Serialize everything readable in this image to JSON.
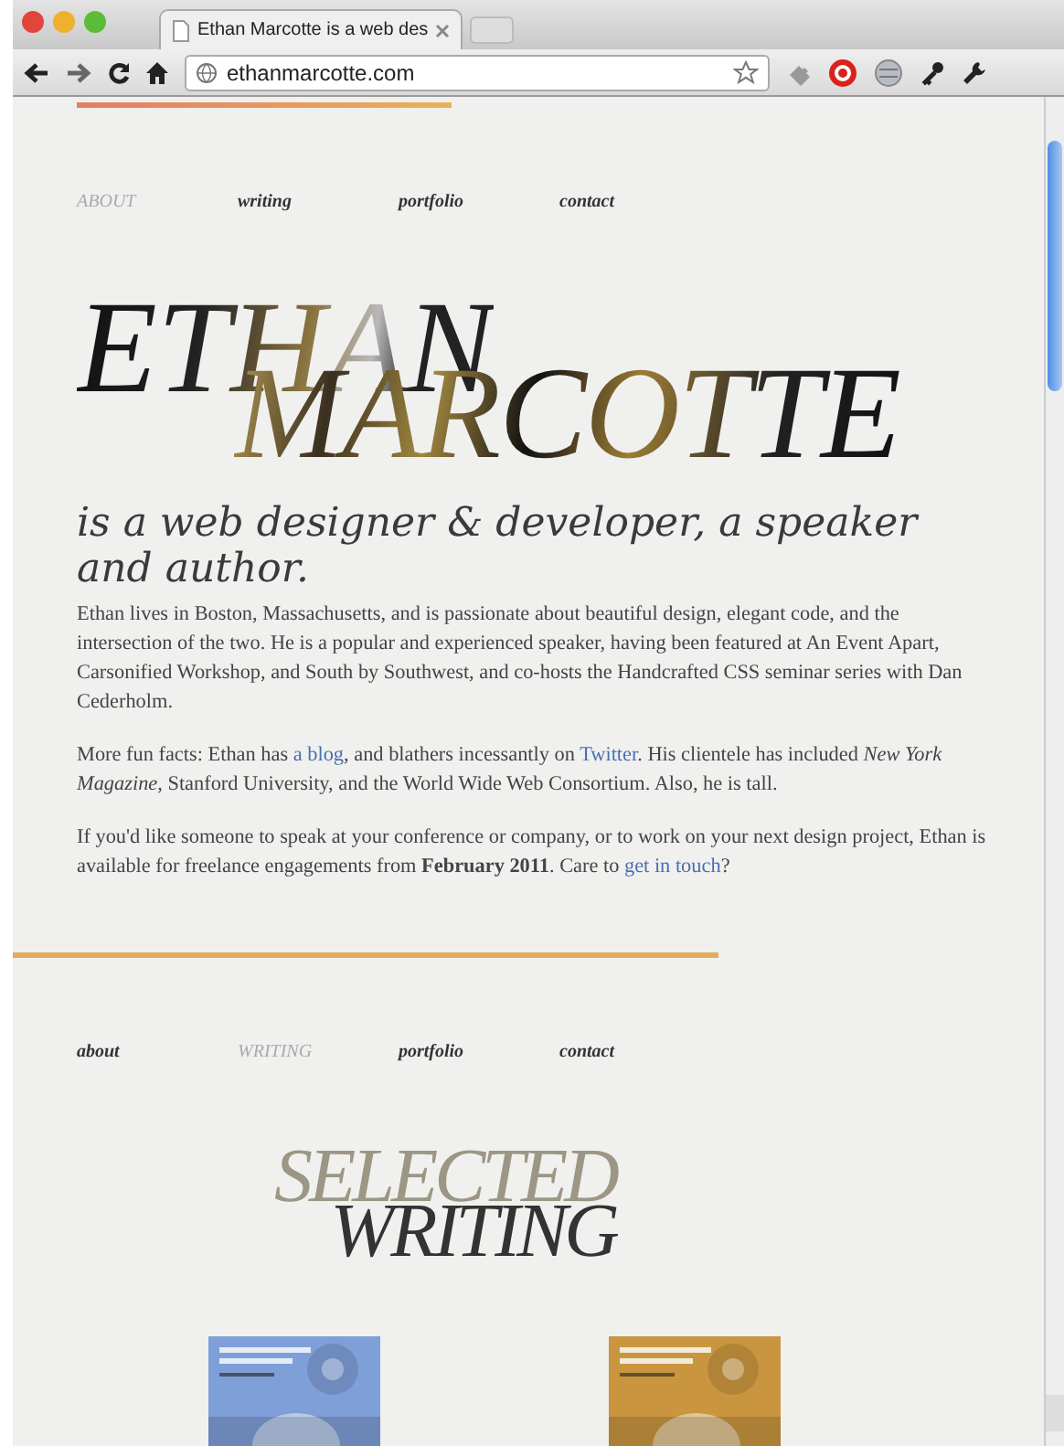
{
  "browser": {
    "tab_title": "Ethan Marcotte is a web des",
    "url": "ethanmarcotte.com"
  },
  "nav_top": [
    {
      "label": "ABOUT",
      "selected": true
    },
    {
      "label": "writing",
      "selected": false
    },
    {
      "label": "portfolio",
      "selected": false
    },
    {
      "label": "contact",
      "selected": false
    }
  ],
  "name": {
    "first": "ETHAN",
    "last": "MARCOTTE"
  },
  "tagline": "is a web designer & developer, a speaker and author.",
  "paragraphs": [
    [
      {
        "kind": "text",
        "text": "Ethan lives in Boston, Massachusetts, and is passionate about beautiful design, elegant code, and the intersection of the two. He is a popular and experienced speaker, having been featured at An Event Apart, Carsonified Workshop, and South by Southwest, and co-hosts the Handcrafted CSS seminar series with Dan Cederholm."
      }
    ],
    [
      {
        "kind": "text",
        "text": "More fun facts: Ethan has "
      },
      {
        "kind": "link",
        "text": "a blog"
      },
      {
        "kind": "text",
        "text": ", and blathers incessantly on "
      },
      {
        "kind": "link",
        "text": "Twitter"
      },
      {
        "kind": "text",
        "text": ". His clientele has included "
      },
      {
        "kind": "em",
        "text": "New York Magazine"
      },
      {
        "kind": "text",
        "text": ", Stanford University, and the World Wide Web Consortium. Also, he is tall."
      }
    ],
    [
      {
        "kind": "text",
        "text": "If you'd like someone to speak at your conference or company, or to work on your next design project, Ethan is available for freelance engagements from "
      },
      {
        "kind": "strong",
        "text": "February 2011"
      },
      {
        "kind": "text",
        "text": ". Care to "
      },
      {
        "kind": "link",
        "text": "get in touch"
      },
      {
        "kind": "text",
        "text": "?"
      }
    ]
  ],
  "nav_bottom": [
    {
      "label": "about",
      "selected": false
    },
    {
      "label": "WRITING",
      "selected": true
    },
    {
      "label": "portfolio",
      "selected": false
    },
    {
      "label": "contact",
      "selected": false
    }
  ],
  "section_title": {
    "line_1": "SELECTED",
    "line_2": "WRITING"
  },
  "books": [
    {
      "kind": "picture",
      "color": "#7f9fd8"
    },
    {
      "kind": "picture",
      "color": "#c9963f"
    }
  ]
}
